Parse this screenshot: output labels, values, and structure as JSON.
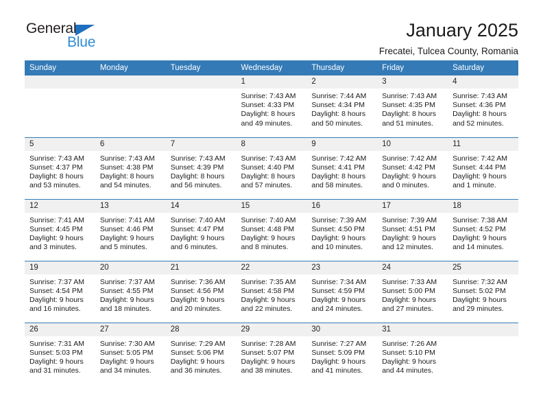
{
  "brand": {
    "name_top": "General",
    "name_bottom": "Blue",
    "triangle_icon": "triangle-icon",
    "color_top": "#231f20",
    "color_bottom": "#2e8bd6",
    "triangle_color": "#1f6fbf"
  },
  "header": {
    "title": "January 2025",
    "subtitle": "Frecatei, Tulcea County, Romania"
  },
  "theme": {
    "header_bg": "#337ab7",
    "header_text": "#ffffff",
    "daynum_bg": "#f0f0f0",
    "cell_bg": "#ffffff",
    "row_divider": "#337ab7"
  },
  "weekdays": [
    "Sunday",
    "Monday",
    "Tuesday",
    "Wednesday",
    "Thursday",
    "Friday",
    "Saturday"
  ],
  "weeks": [
    [
      {
        "day": "",
        "empty": true,
        "lines": []
      },
      {
        "day": "",
        "empty": true,
        "lines": []
      },
      {
        "day": "",
        "empty": true,
        "lines": []
      },
      {
        "day": "1",
        "empty": false,
        "lines": [
          "Sunrise: 7:43 AM",
          "Sunset: 4:33 PM",
          "Daylight: 8 hours",
          "and 49 minutes."
        ]
      },
      {
        "day": "2",
        "empty": false,
        "lines": [
          "Sunrise: 7:44 AM",
          "Sunset: 4:34 PM",
          "Daylight: 8 hours",
          "and 50 minutes."
        ]
      },
      {
        "day": "3",
        "empty": false,
        "lines": [
          "Sunrise: 7:43 AM",
          "Sunset: 4:35 PM",
          "Daylight: 8 hours",
          "and 51 minutes."
        ]
      },
      {
        "day": "4",
        "empty": false,
        "lines": [
          "Sunrise: 7:43 AM",
          "Sunset: 4:36 PM",
          "Daylight: 8 hours",
          "and 52 minutes."
        ]
      }
    ],
    [
      {
        "day": "5",
        "empty": false,
        "lines": [
          "Sunrise: 7:43 AM",
          "Sunset: 4:37 PM",
          "Daylight: 8 hours",
          "and 53 minutes."
        ]
      },
      {
        "day": "6",
        "empty": false,
        "lines": [
          "Sunrise: 7:43 AM",
          "Sunset: 4:38 PM",
          "Daylight: 8 hours",
          "and 54 minutes."
        ]
      },
      {
        "day": "7",
        "empty": false,
        "lines": [
          "Sunrise: 7:43 AM",
          "Sunset: 4:39 PM",
          "Daylight: 8 hours",
          "and 56 minutes."
        ]
      },
      {
        "day": "8",
        "empty": false,
        "lines": [
          "Sunrise: 7:43 AM",
          "Sunset: 4:40 PM",
          "Daylight: 8 hours",
          "and 57 minutes."
        ]
      },
      {
        "day": "9",
        "empty": false,
        "lines": [
          "Sunrise: 7:42 AM",
          "Sunset: 4:41 PM",
          "Daylight: 8 hours",
          "and 58 minutes."
        ]
      },
      {
        "day": "10",
        "empty": false,
        "lines": [
          "Sunrise: 7:42 AM",
          "Sunset: 4:42 PM",
          "Daylight: 9 hours",
          "and 0 minutes."
        ]
      },
      {
        "day": "11",
        "empty": false,
        "lines": [
          "Sunrise: 7:42 AM",
          "Sunset: 4:44 PM",
          "Daylight: 9 hours",
          "and 1 minute."
        ]
      }
    ],
    [
      {
        "day": "12",
        "empty": false,
        "lines": [
          "Sunrise: 7:41 AM",
          "Sunset: 4:45 PM",
          "Daylight: 9 hours",
          "and 3 minutes."
        ]
      },
      {
        "day": "13",
        "empty": false,
        "lines": [
          "Sunrise: 7:41 AM",
          "Sunset: 4:46 PM",
          "Daylight: 9 hours",
          "and 5 minutes."
        ]
      },
      {
        "day": "14",
        "empty": false,
        "lines": [
          "Sunrise: 7:40 AM",
          "Sunset: 4:47 PM",
          "Daylight: 9 hours",
          "and 6 minutes."
        ]
      },
      {
        "day": "15",
        "empty": false,
        "lines": [
          "Sunrise: 7:40 AM",
          "Sunset: 4:48 PM",
          "Daylight: 9 hours",
          "and 8 minutes."
        ]
      },
      {
        "day": "16",
        "empty": false,
        "lines": [
          "Sunrise: 7:39 AM",
          "Sunset: 4:50 PM",
          "Daylight: 9 hours",
          "and 10 minutes."
        ]
      },
      {
        "day": "17",
        "empty": false,
        "lines": [
          "Sunrise: 7:39 AM",
          "Sunset: 4:51 PM",
          "Daylight: 9 hours",
          "and 12 minutes."
        ]
      },
      {
        "day": "18",
        "empty": false,
        "lines": [
          "Sunrise: 7:38 AM",
          "Sunset: 4:52 PM",
          "Daylight: 9 hours",
          "and 14 minutes."
        ]
      }
    ],
    [
      {
        "day": "19",
        "empty": false,
        "lines": [
          "Sunrise: 7:37 AM",
          "Sunset: 4:54 PM",
          "Daylight: 9 hours",
          "and 16 minutes."
        ]
      },
      {
        "day": "20",
        "empty": false,
        "lines": [
          "Sunrise: 7:37 AM",
          "Sunset: 4:55 PM",
          "Daylight: 9 hours",
          "and 18 minutes."
        ]
      },
      {
        "day": "21",
        "empty": false,
        "lines": [
          "Sunrise: 7:36 AM",
          "Sunset: 4:56 PM",
          "Daylight: 9 hours",
          "and 20 minutes."
        ]
      },
      {
        "day": "22",
        "empty": false,
        "lines": [
          "Sunrise: 7:35 AM",
          "Sunset: 4:58 PM",
          "Daylight: 9 hours",
          "and 22 minutes."
        ]
      },
      {
        "day": "23",
        "empty": false,
        "lines": [
          "Sunrise: 7:34 AM",
          "Sunset: 4:59 PM",
          "Daylight: 9 hours",
          "and 24 minutes."
        ]
      },
      {
        "day": "24",
        "empty": false,
        "lines": [
          "Sunrise: 7:33 AM",
          "Sunset: 5:00 PM",
          "Daylight: 9 hours",
          "and 27 minutes."
        ]
      },
      {
        "day": "25",
        "empty": false,
        "lines": [
          "Sunrise: 7:32 AM",
          "Sunset: 5:02 PM",
          "Daylight: 9 hours",
          "and 29 minutes."
        ]
      }
    ],
    [
      {
        "day": "26",
        "empty": false,
        "lines": [
          "Sunrise: 7:31 AM",
          "Sunset: 5:03 PM",
          "Daylight: 9 hours",
          "and 31 minutes."
        ]
      },
      {
        "day": "27",
        "empty": false,
        "lines": [
          "Sunrise: 7:30 AM",
          "Sunset: 5:05 PM",
          "Daylight: 9 hours",
          "and 34 minutes."
        ]
      },
      {
        "day": "28",
        "empty": false,
        "lines": [
          "Sunrise: 7:29 AM",
          "Sunset: 5:06 PM",
          "Daylight: 9 hours",
          "and 36 minutes."
        ]
      },
      {
        "day": "29",
        "empty": false,
        "lines": [
          "Sunrise: 7:28 AM",
          "Sunset: 5:07 PM",
          "Daylight: 9 hours",
          "and 38 minutes."
        ]
      },
      {
        "day": "30",
        "empty": false,
        "lines": [
          "Sunrise: 7:27 AM",
          "Sunset: 5:09 PM",
          "Daylight: 9 hours",
          "and 41 minutes."
        ]
      },
      {
        "day": "31",
        "empty": false,
        "lines": [
          "Sunrise: 7:26 AM",
          "Sunset: 5:10 PM",
          "Daylight: 9 hours",
          "and 44 minutes."
        ]
      },
      {
        "day": "",
        "empty": true,
        "lines": []
      }
    ]
  ]
}
